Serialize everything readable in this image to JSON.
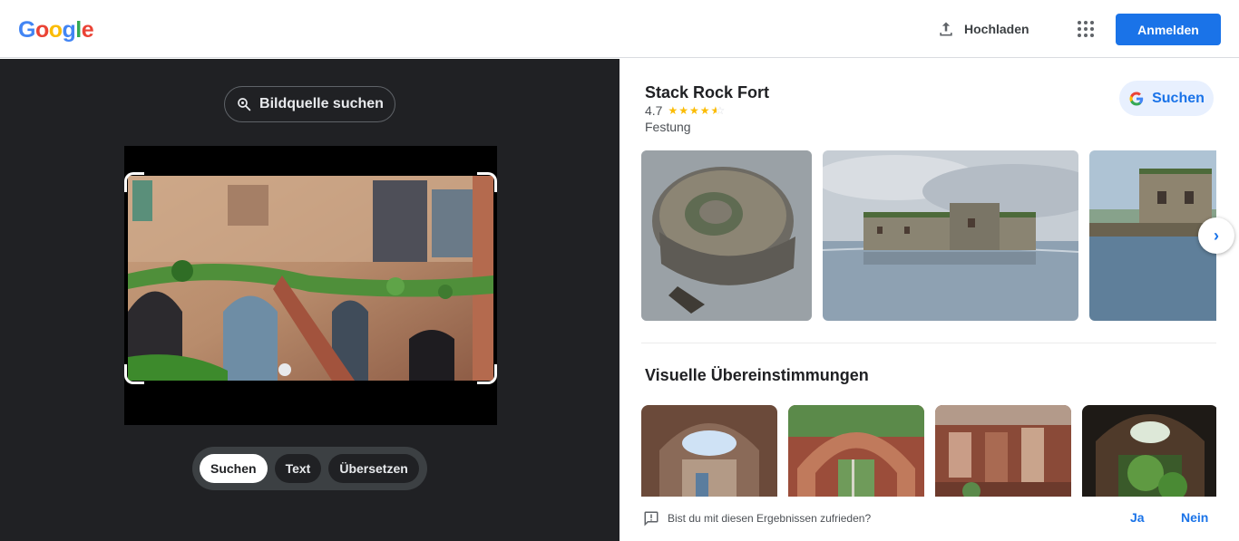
{
  "header": {
    "logo_letters": [
      "G",
      "o",
      "o",
      "g",
      "l",
      "e"
    ],
    "logo_colors": [
      "#4285f4",
      "#ea4335",
      "#fbbc05",
      "#4285f4",
      "#34a853",
      "#ea4335"
    ],
    "upload_label": "Hochladen",
    "upload_icon": "upload-icon",
    "apps_icon": "apps-grid-icon",
    "signin_label": "Anmelden"
  },
  "left_panel": {
    "source_button_label": "Bildquelle suchen",
    "source_button_icon": "lens-search-icon",
    "modes": [
      {
        "label": "Suchen",
        "active": true
      },
      {
        "label": "Text",
        "active": false
      },
      {
        "label": "Übersetzen",
        "active": false
      }
    ]
  },
  "knowledge_panel": {
    "title": "Stack Rock Fort",
    "rating": "4.7",
    "stars_filled": 4.5,
    "category": "Festung",
    "search_button_label": "Suchen",
    "search_button_icon": "google-g-icon",
    "next_icon": "chevron-right-icon"
  },
  "visual_matches": {
    "title": "Visuelle Übereinstimmungen"
  },
  "feedback": {
    "icon": "feedback-icon",
    "question": "Bist du mit diesen Ergebnissen zufrieden?",
    "yes_label": "Ja",
    "no_label": "Nein"
  },
  "colors": {
    "accent": "#1a73e8",
    "dark_bg": "#202124",
    "star": "#fbbc04"
  }
}
